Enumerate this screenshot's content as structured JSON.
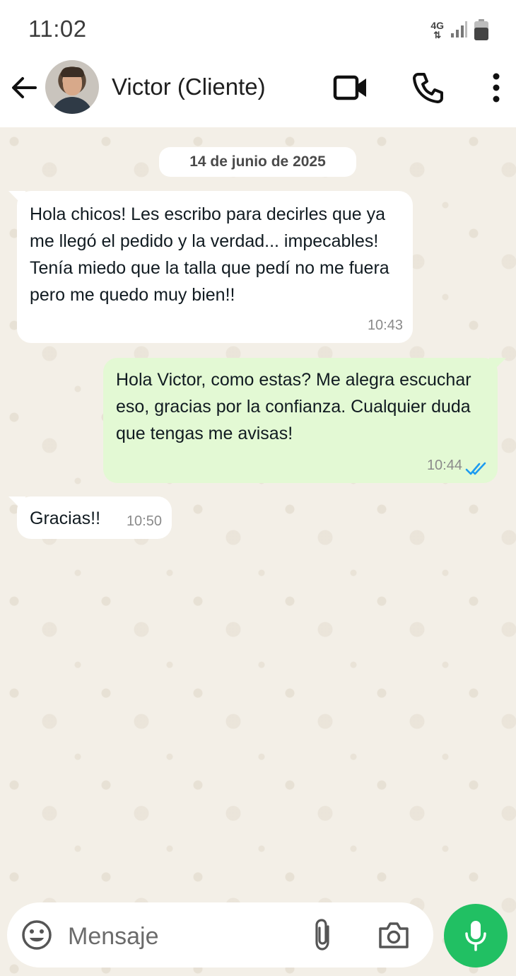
{
  "status_bar": {
    "time": "11:02",
    "network": "4G",
    "icons": [
      "data-arrows-icon",
      "signal-icon",
      "battery-icon"
    ]
  },
  "header": {
    "contact_name": "Victor (Cliente)",
    "icons": [
      "back-arrow-icon",
      "avatar",
      "video-call-icon",
      "voice-call-icon",
      "more-options-icon"
    ]
  },
  "chat": {
    "date_chip": "14 de junio de 2025",
    "messages": [
      {
        "direction": "incoming",
        "text": "Hola chicos! Les escribo para decirles que ya me llegó el pedido y la verdad... impecables! Tenía miedo que la talla que pedí no me fuera pero me quedo muy bien!!",
        "time": "10:43"
      },
      {
        "direction": "outgoing",
        "text": "Hola Victor, como estas? Me alegra escuchar eso, gracias por la confianza. Cualquier duda que tengas me avisas!",
        "time": "10:44",
        "status": "read",
        "status_icon": "double-check-icon"
      },
      {
        "direction": "incoming",
        "text": "Gracias!!",
        "time": "10:50"
      }
    ]
  },
  "composer": {
    "placeholder": "Mensaje",
    "value": "",
    "icons": [
      "emoji-icon",
      "attach-icon",
      "camera-icon",
      "mic-icon"
    ]
  },
  "colors": {
    "incoming_bubble": "#ffffff",
    "outgoing_bubble": "#e3f9d4",
    "chat_background": "#f3efe7",
    "mic_button": "#21c063",
    "read_check": "#1d9bf0"
  }
}
